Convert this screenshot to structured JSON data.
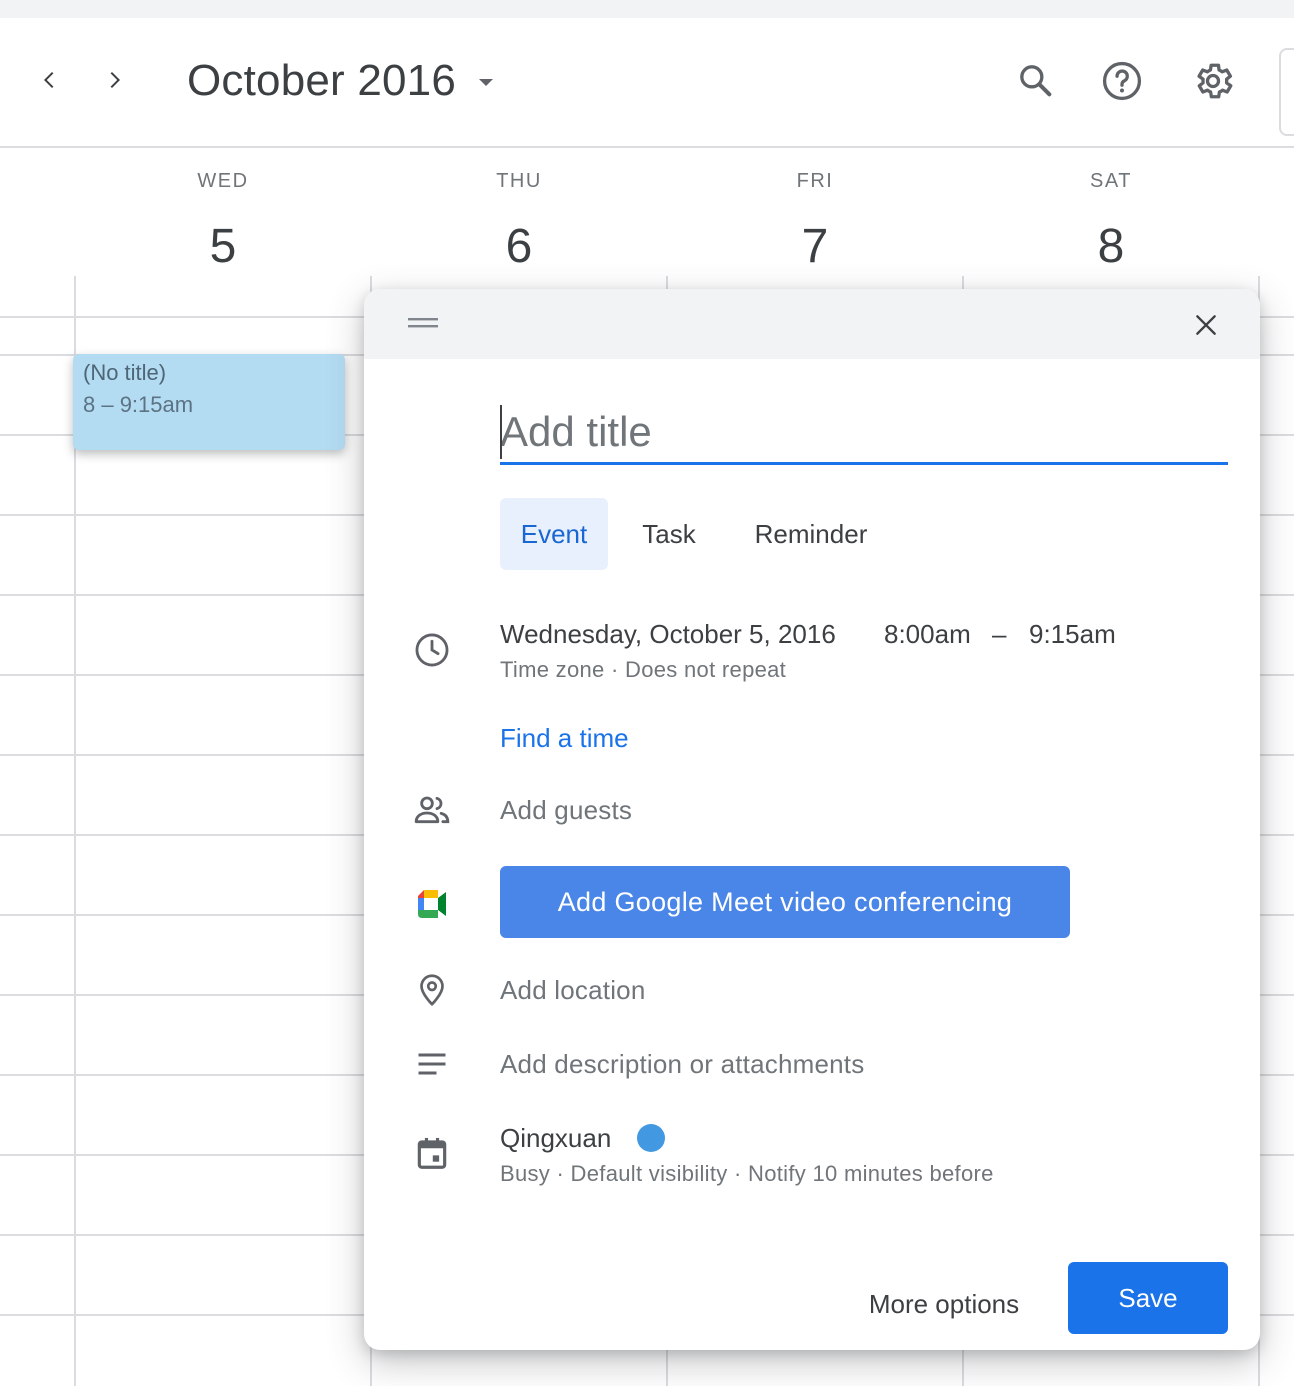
{
  "header": {
    "month_title": "October 2016",
    "icons": {
      "prev": "chevron-left-icon",
      "next": "chevron-right-icon",
      "caret": "caret-down-icon",
      "search": "search-icon",
      "help": "help-icon",
      "settings": "gear-icon"
    }
  },
  "days": [
    {
      "name": "WED",
      "number": "5"
    },
    {
      "name": "THU",
      "number": "6"
    },
    {
      "name": "FRI",
      "number": "7"
    },
    {
      "name": "SAT",
      "number": "8"
    }
  ],
  "event_chip": {
    "title": "(No title)",
    "time": "8 – 9:15am"
  },
  "dialog": {
    "title_placeholder": "Add title",
    "tabs": [
      {
        "label": "Event",
        "active": true
      },
      {
        "label": "Task",
        "active": false
      },
      {
        "label": "Reminder",
        "active": false
      }
    ],
    "date_time": {
      "date": "Wednesday, October 5, 2016",
      "start": "8:00am",
      "separator": "–",
      "end": "9:15am",
      "sub": "Time zone · Does not repeat"
    },
    "find_time": "Find a time",
    "add_guests": "Add guests",
    "meet_button": "Add Google Meet video conferencing",
    "add_location": "Add location",
    "add_description": "Add description or attachments",
    "calendar": {
      "name": "Qingxuan",
      "color": "#4299e1",
      "sub": "Busy · Default visibility · Notify 10 minutes before"
    },
    "more_options": "More options",
    "save": "Save"
  },
  "colors": {
    "accent": "#1a73e8",
    "meet_button": "#4a86e8",
    "event_chip": "#b3dbf2"
  }
}
